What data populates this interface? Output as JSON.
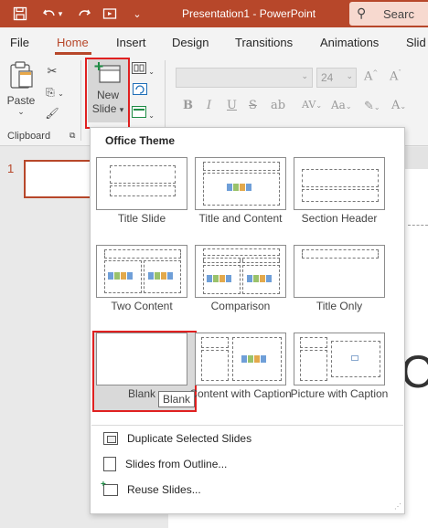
{
  "window": {
    "title": "Presentation1  -  PowerPoint",
    "search_placeholder": "Searc"
  },
  "tabs": [
    "File",
    "Home",
    "Insert",
    "Design",
    "Transitions",
    "Animations",
    "Slid"
  ],
  "active_tab": "Home",
  "ribbon": {
    "paste_label": "Paste",
    "clipboard_group": "Clipboard",
    "new_slide_line1": "New",
    "new_slide_line2": "Slide",
    "font_size": "24"
  },
  "slides_panel": {
    "slide_number": "1"
  },
  "canvas": {
    "partial_text": "C"
  },
  "gallery": {
    "title": "Office Theme",
    "layouts": [
      {
        "name": "Title Slide"
      },
      {
        "name": "Title and Content"
      },
      {
        "name": "Section Header"
      },
      {
        "name": "Two Content"
      },
      {
        "name": "Comparison"
      },
      {
        "name": "Title Only"
      },
      {
        "name": "Blank"
      },
      {
        "name": "Content with Caption"
      },
      {
        "name": "Picture with Caption"
      }
    ],
    "tooltip": "Blank",
    "menu": [
      {
        "label": "Duplicate Selected Slides"
      },
      {
        "label": "Slides from Outline..."
      },
      {
        "label": "Reuse Slides..."
      }
    ]
  },
  "colors": {
    "accent": "#b7472a",
    "highlight": "#e02020"
  }
}
